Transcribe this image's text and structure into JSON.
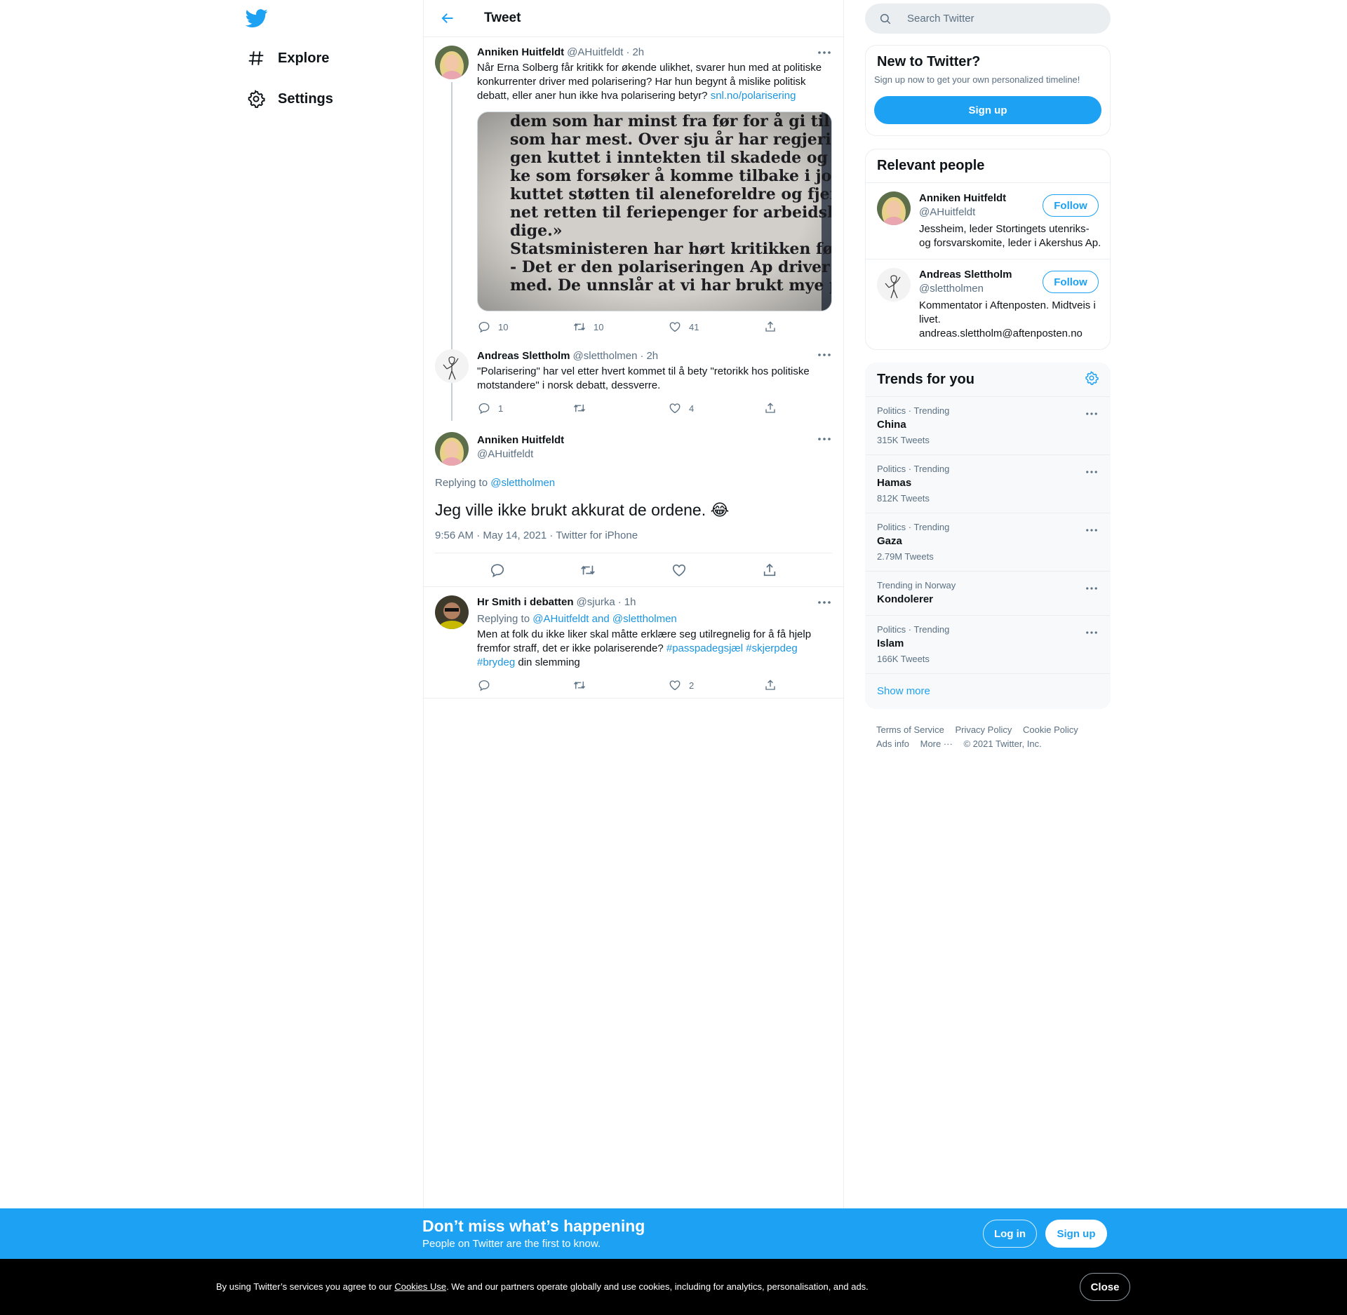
{
  "nav": {
    "logo_icon": "twitter-bird-icon",
    "items": [
      {
        "label": "Explore",
        "icon": "hashtag-icon"
      },
      {
        "label": "Settings",
        "icon": "gear-icon"
      }
    ]
  },
  "header": {
    "title": "Tweet",
    "back_icon": "back-arrow-icon"
  },
  "thread": [
    {
      "name": "Anniken Huitfeldt",
      "handle": "@AHuitfeldt",
      "time": "2h",
      "text": "Når Erna Solberg får kritikk for økende ulikhet, svarer hun med at politiske konkurrenter driver med polarisering? Har hun begynt å mislike politisk debatt, eller aner hun ikke hva polarisering betyr? ",
      "link": "snl.no/polarisering",
      "image_text": [
        "dem som har minst fra før for å gi til de",
        "som har mest. Over sju år har regjerin-",
        "gen kuttet i inntekten til skadede og sy-",
        "ke som forsøker å komme tilbake i jobb,",
        "kuttet støtten til aleneforeldre og fjer-",
        "net retten til feriepenger for arbeidsle-",
        "dige.»",
        "   Statsministeren har hørt kritikken før:",
        "   - Det er den polariseringen Ap driver",
        "med. De unnslår at vi har brukt mye pen-"
      ],
      "replies": "10",
      "retweets": "10",
      "likes": "41"
    },
    {
      "name": "Andreas Slettholm",
      "handle": "@slettholmen",
      "time": "2h",
      "text": "\"Polarisering\" har vel etter hvert kommet til å bety \"retorikk hos politiske motstandere\" i norsk debatt, dessverre.",
      "replies": "1",
      "retweets": "",
      "likes": "4"
    }
  ],
  "focal": {
    "name": "Anniken Huitfeldt",
    "handle": "@AHuitfeldt",
    "replying_prefix": "Replying to ",
    "replying_to": "@slettholmen",
    "text": "Jeg ville ikke brukt akkurat de ordene. 😂",
    "meta": "9:56 AM · May 14, 2021 · Twitter for iPhone"
  },
  "reply": {
    "name": "Hr Smith i debatten",
    "handle": "@sjurka",
    "time": "1h",
    "replying_prefix": "Replying to ",
    "replying_to": "@AHuitfeldt and @slettholmen",
    "text": "Men at folk du ikke liker skal måtte erklære seg utilregnelig for å få hjelp fremfor straff, det er ikke polariserende? ",
    "tag1": "#passpadegsjæl",
    "tag2": "#skjerpdeg",
    "tag3": "#brydeg",
    "text_end": " din slemming",
    "replies": "",
    "retweets": "",
    "likes": "2"
  },
  "search": {
    "placeholder": "Search Twitter"
  },
  "new_to_twitter": {
    "title": "New to Twitter?",
    "subtitle": "Sign up now to get your own personalized timeline!",
    "button": "Sign up"
  },
  "relevant_people": {
    "title": "Relevant people",
    "people": [
      {
        "name": "Anniken Huitfeldt",
        "handle": "@AHuitfeldt",
        "bio": "Jessheim, leder Stortingets utenriks- og forsvarskomite, leder i Akershus Ap.",
        "button": "Follow"
      },
      {
        "name": "Andreas Slettholm",
        "handle": "@slettholmen",
        "bio": "Kommentator i Aftenposten. Midtveis i livet. andreas.slettholm@aftenposten.no",
        "button": "Follow"
      }
    ]
  },
  "trends": {
    "title": "Trends for you",
    "items": [
      {
        "category": "Politics · Trending",
        "name": "China",
        "count": "315K Tweets"
      },
      {
        "category": "Politics · Trending",
        "name": "Hamas",
        "count": "812K Tweets"
      },
      {
        "category": "Politics · Trending",
        "name": "Gaza",
        "count": "2.79M Tweets"
      },
      {
        "category": "Trending in Norway",
        "name": "Kondolerer",
        "count": ""
      },
      {
        "category": "Politics · Trending",
        "name": "Islam",
        "count": "166K Tweets"
      }
    ],
    "show_more": "Show more"
  },
  "footer": {
    "terms": "Terms of Service",
    "privacy": "Privacy Policy",
    "cookie": "Cookie Policy",
    "ads": "Ads info",
    "more": "More ···",
    "copyright": "© 2021 Twitter, Inc."
  },
  "bottom_bar": {
    "title": "Don’t miss what’s happening",
    "subtitle": "People on Twitter are the first to know.",
    "login": "Log in",
    "signup": "Sign up"
  },
  "cookie_bar": {
    "prefix": "By using Twitter’s services you agree to our ",
    "link": "Cookies Use",
    "suffix": ". We and our partners operate globally and use cookies, including for analytics, personalisation, and ads.",
    "close": "Close"
  },
  "colors": {
    "accent": "#1da1f2",
    "link": "#1b95e0",
    "muted": "#5b7083"
  }
}
